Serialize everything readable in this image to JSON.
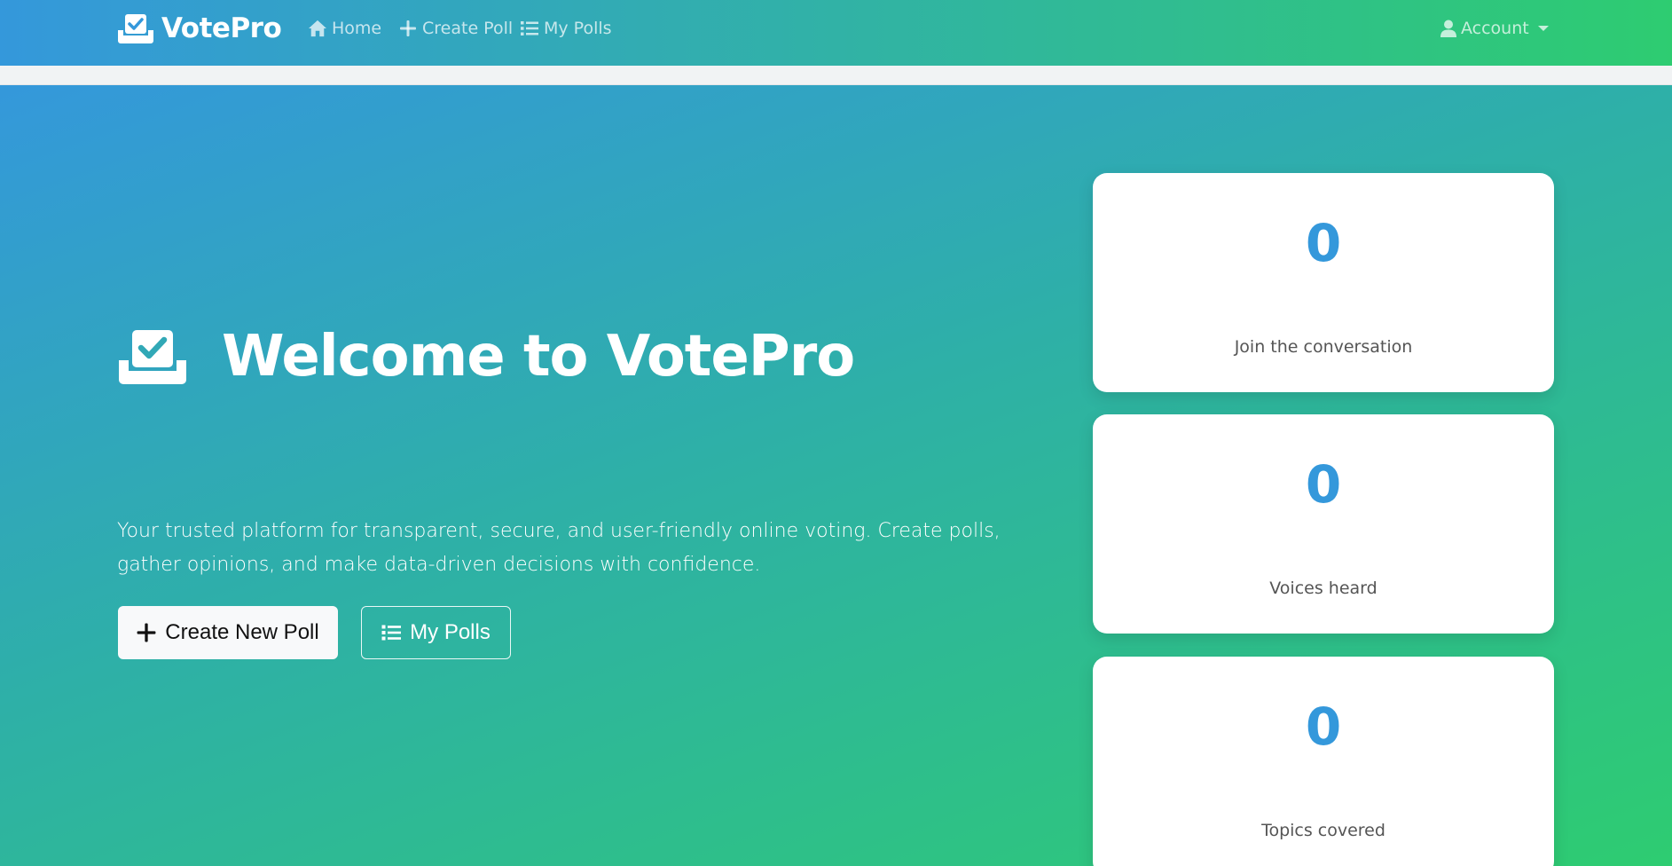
{
  "brand": {
    "name": "VotePro",
    "icon": "ballot-check-icon"
  },
  "nav": {
    "home": {
      "label": "Home",
      "icon": "home-icon"
    },
    "create_poll": {
      "label": "Create Poll",
      "icon": "plus-icon"
    },
    "my_polls": {
      "label": "My Polls",
      "icon": "list-icon"
    },
    "account": {
      "label": "Account",
      "icon": "user-icon"
    }
  },
  "hero": {
    "title": "Welcome to VotePro",
    "description": "Your trusted platform for transparent, secure, and user-friendly online voting. Create polls, gather opinions, and make data-driven decisions with confidence.",
    "create_button": "Create New Poll",
    "my_polls_button": "My Polls"
  },
  "stats": [
    {
      "value": "0",
      "label": "Join the conversation"
    },
    {
      "value": "0",
      "label": "Voices heard"
    },
    {
      "value": "0",
      "label": "Topics covered"
    }
  ],
  "colors": {
    "primary_blue": "#3498db",
    "primary_green": "#2ecc71"
  }
}
